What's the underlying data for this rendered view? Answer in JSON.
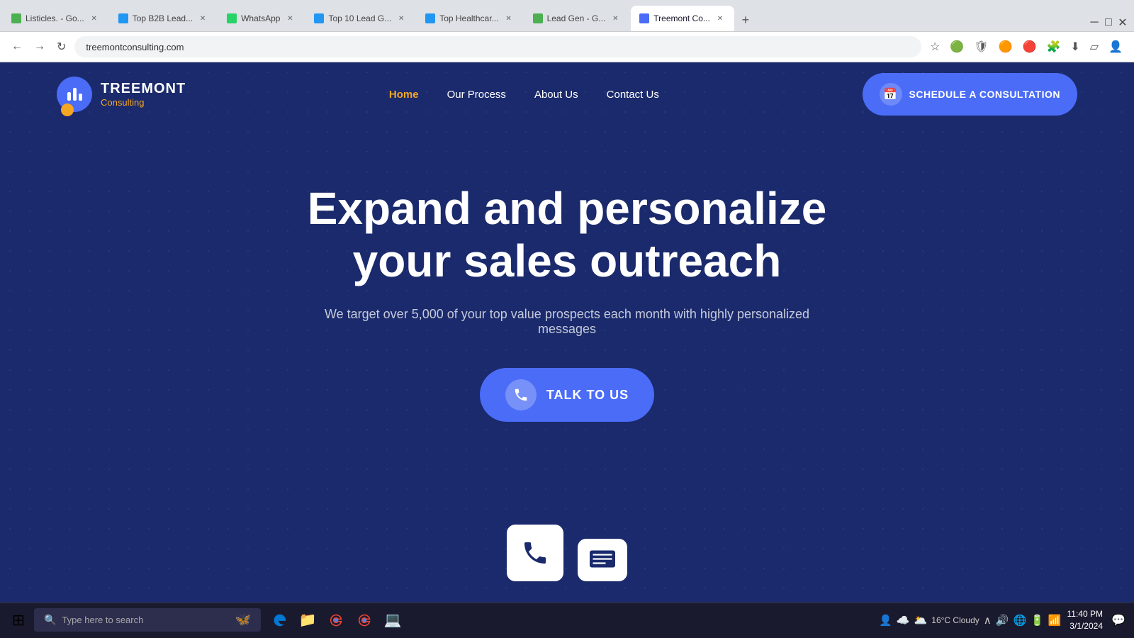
{
  "browser": {
    "url": "treemontconsulting.com",
    "tabs": [
      {
        "id": "tab1",
        "label": "Listicles. - Go...",
        "favicon_color": "#4caf50",
        "active": false
      },
      {
        "id": "tab2",
        "label": "Top B2B Lead...",
        "favicon_color": "#2196f3",
        "active": false
      },
      {
        "id": "tab3",
        "label": "WhatsApp",
        "favicon_color": "#25d366",
        "active": false
      },
      {
        "id": "tab4",
        "label": "Top 10 Lead G...",
        "favicon_color": "#2196f3",
        "active": false
      },
      {
        "id": "tab5",
        "label": "Top Healthcar...",
        "favicon_color": "#2196f3",
        "active": false
      },
      {
        "id": "tab6",
        "label": "Lead Gen - G...",
        "favicon_color": "#4caf50",
        "active": false
      },
      {
        "id": "tab7",
        "label": "Treemont Co...",
        "favicon_color": "#4a6cf7",
        "active": true
      }
    ]
  },
  "navbar": {
    "logo_name": "TREEMONT",
    "logo_sub": "Consulting",
    "links": [
      {
        "label": "Home",
        "active": true
      },
      {
        "label": "Our Process",
        "active": false
      },
      {
        "label": "About Us",
        "active": false
      },
      {
        "label": "Contact Us",
        "active": false
      }
    ],
    "cta_label": "SCHEDULE A CONSULTATION"
  },
  "hero": {
    "title_line1": "Expand and personalize",
    "title_line2": "your sales outreach",
    "subtitle": "We target over 5,000 of your top value prospects each month with highly personalized messages",
    "cta_label": "TALK TO US"
  },
  "taskbar": {
    "search_placeholder": "Type here to search",
    "apps": [
      "📁",
      "🌐",
      "🟠",
      "🟠",
      "🟤"
    ],
    "weather": "16°C  Cloudy",
    "time": "11:40 PM",
    "date": "3/1/2024"
  }
}
